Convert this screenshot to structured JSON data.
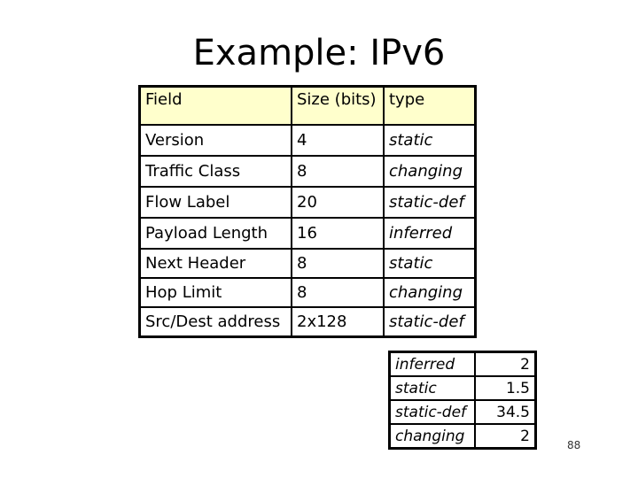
{
  "title": "Example: IPv6",
  "main_table": {
    "headers": [
      "Field",
      "Size (bits)",
      "type"
    ],
    "rows": [
      {
        "field": "Version",
        "size": "4",
        "type": "static"
      },
      {
        "field": "Traffic Class",
        "size": "8",
        "type": "changing"
      },
      {
        "field": "Flow Label",
        "size": "20",
        "type": "static-def"
      },
      {
        "field": "Payload Length",
        "size": "16",
        "type": "inferred"
      },
      {
        "field": "Next Header",
        "size": "8",
        "type": "static"
      },
      {
        "field": "Hop Limit",
        "size": "8",
        "type": "changing"
      },
      {
        "field": "Src/Dest address",
        "size": "2x128",
        "type": "static-def"
      }
    ]
  },
  "summary_table": {
    "rows": [
      {
        "type": "inferred",
        "bytes": "2"
      },
      {
        "type": "static",
        "bytes": "1.5"
      },
      {
        "type": "static-def",
        "bytes": "34.5"
      },
      {
        "type": "changing",
        "bytes": "2"
      }
    ]
  },
  "page_number": "88",
  "colors": {
    "header_fill": "#FFFFCC",
    "border": "#000000"
  }
}
